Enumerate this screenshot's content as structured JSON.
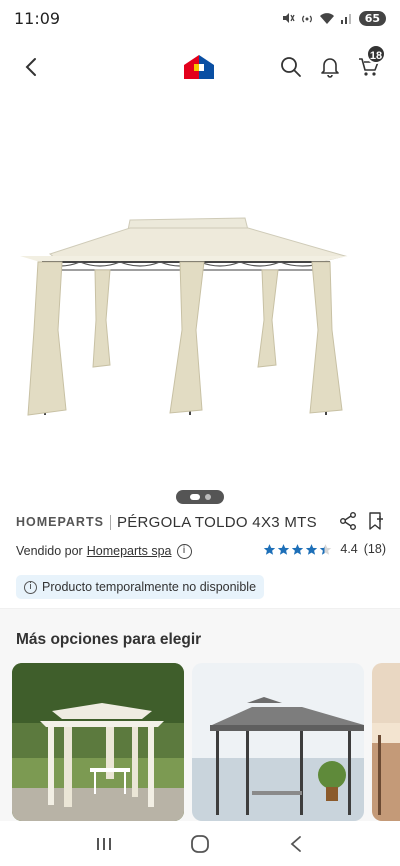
{
  "status": {
    "time": "11:09",
    "battery": "65"
  },
  "nav": {
    "cart_count": "18",
    "icons": [
      "back-arrow-icon",
      "house-logo-icon",
      "search-icon",
      "bell-icon",
      "cart-icon"
    ]
  },
  "product": {
    "brand": "HOMEPARTS",
    "name": "PÉRGOLA TOLDO 4X3 MTS",
    "seller_prefix": "Vendido por",
    "seller_name": "Homeparts spa",
    "rating_value": "4.4",
    "rating_count": "(18)",
    "rating_stars": 4.4,
    "availability": "Producto temporalmente no disponible",
    "gallery_count": 2,
    "gallery_index": 0
  },
  "more_options": {
    "title": "Más opciones para elegir"
  },
  "colors": {
    "star": "#1d6fb8",
    "notice_bg": "#e8f3fb",
    "brand_logo_red": "#e3001b",
    "brand_logo_yellow": "#f7c600",
    "brand_logo_blue": "#0a4fa3"
  }
}
